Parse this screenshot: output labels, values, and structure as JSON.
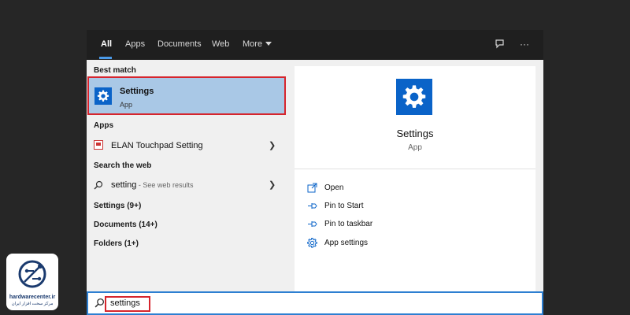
{
  "tabs": [
    {
      "label": "All",
      "active": true
    },
    {
      "label": "Apps"
    },
    {
      "label": "Documents"
    },
    {
      "label": "Web"
    },
    {
      "label": "More"
    }
  ],
  "top_icons": {
    "feedback": "feedback-icon",
    "more": "···"
  },
  "left": {
    "best_match_header": "Best match",
    "best_match": {
      "title": "Settings",
      "subtitle": "App",
      "icon": "gear-icon"
    },
    "apps_header": "Apps",
    "apps_item": {
      "label": "ELAN Touchpad Setting",
      "icon": "touchpad-app-icon"
    },
    "web_header": "Search the web",
    "web_item": {
      "query": "setting",
      "suffix": " - See web results",
      "icon": "search-icon"
    },
    "settings_header": "Settings (9+)",
    "documents_header": "Documents (14+)",
    "folders_header": "Folders (1+)"
  },
  "right": {
    "title": "Settings",
    "subtitle": "App",
    "actions": [
      {
        "label": "Open",
        "icon": "open-icon"
      },
      {
        "label": "Pin to Start",
        "icon": "pin-icon"
      },
      {
        "label": "Pin to taskbar",
        "icon": "pin-icon"
      },
      {
        "label": "App settings",
        "icon": "gear-icon"
      }
    ]
  },
  "search": {
    "value": "settings"
  },
  "logo": {
    "name": "hardwarecenter.ir",
    "tagline": "مرکز سخت افزار ایران"
  },
  "colors": {
    "accent": "#0a63c8",
    "highlight": "#d6252d",
    "selected": "#a9c8e6"
  }
}
